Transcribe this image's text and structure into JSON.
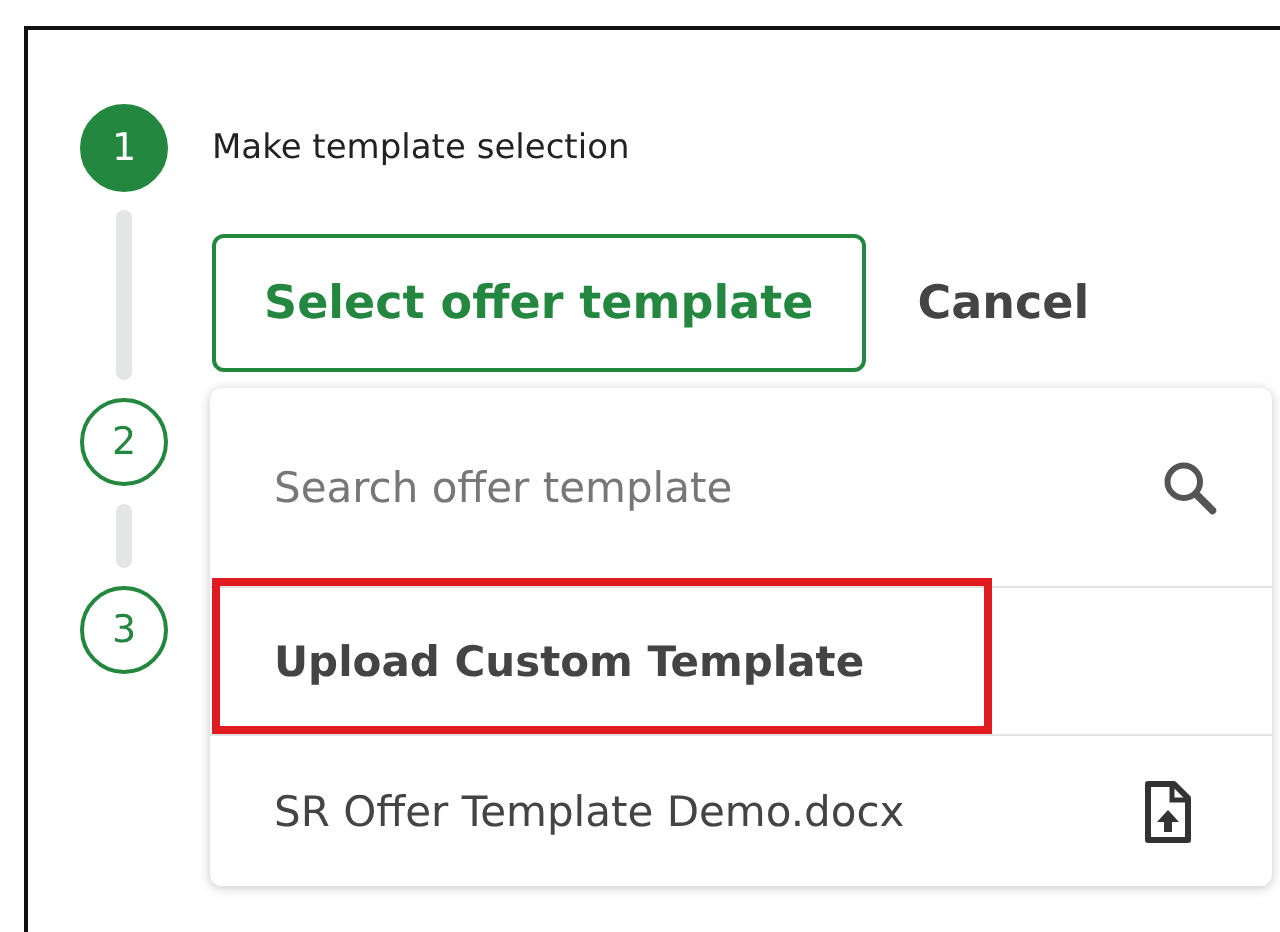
{
  "steps": [
    {
      "number": "1",
      "active": true,
      "label": "Make template selection"
    },
    {
      "number": "2",
      "active": false
    },
    {
      "number": "3",
      "active": false
    }
  ],
  "select_button": "Select offer template",
  "cancel_button": "Cancel",
  "dropdown": {
    "search": {
      "placeholder": "Search offer template"
    },
    "items": [
      {
        "kind": "action",
        "label": "Upload Custom Template",
        "highlighted": true
      },
      {
        "kind": "file",
        "label": "SR Offer Template Demo.docx",
        "highlighted": false
      }
    ]
  }
}
